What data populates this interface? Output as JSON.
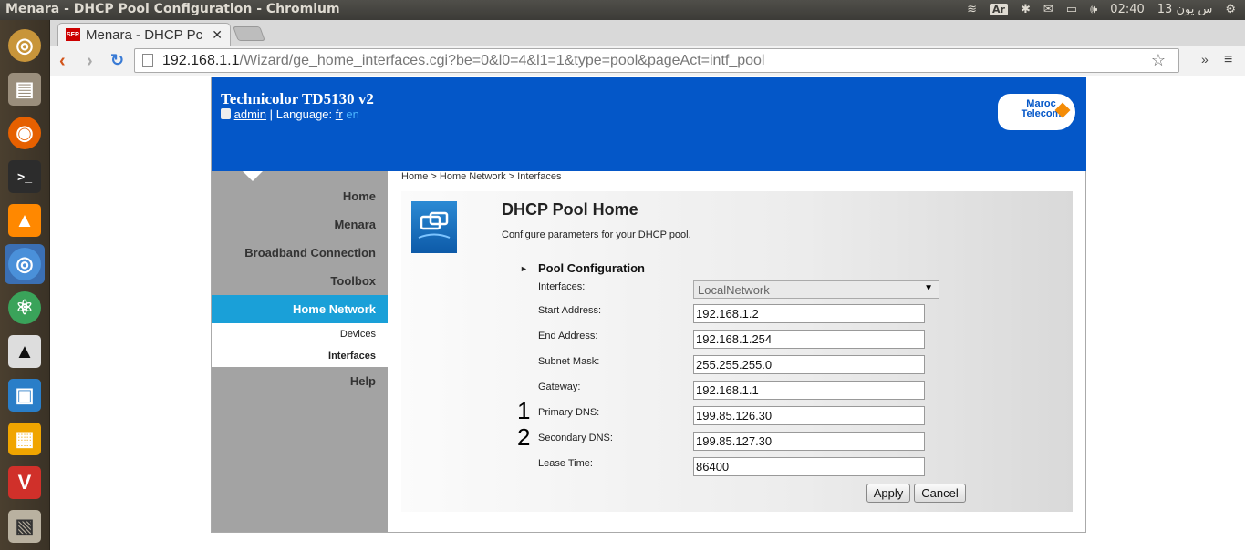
{
  "os": {
    "window_title": "Menara - DHCP Pool Configuration - Chromium",
    "input_indicator": "Ar",
    "clock": "02:40",
    "date": "13 س يون"
  },
  "browser": {
    "tab_title": "Menara - DHCP Pc",
    "tab_favicon": "SFR",
    "url_host": "192.168.1.1",
    "url_path": "/Wizard/ge_home_interfaces.cgi?be=0&l0=4&l1=1&type=pool&pageAct=intf_pool"
  },
  "header": {
    "model": "Technicolor TD5130 v2",
    "user": "admin",
    "language_label": "Language:",
    "lang_fr": "fr",
    "lang_en": "en",
    "logo_line1": "Maroc",
    "logo_line2": "Telecom"
  },
  "sidebar": {
    "home": "Home",
    "menara": "Menara",
    "broadband": "Broadband Connection",
    "toolbox": "Toolbox",
    "home_network": "Home Network",
    "devices": "Devices",
    "interfaces": "Interfaces",
    "help": "Help"
  },
  "breadcrumb": "Home > Home Network > Interfaces",
  "main": {
    "title": "DHCP Pool Home",
    "description": "Configure parameters for your DHCP pool.",
    "section": "Pool Configuration",
    "section_arrow": "►"
  },
  "form": {
    "interfaces_label": "Interfaces:",
    "interfaces_value": "LocalNetwork",
    "start_label": "Start Address:",
    "start_value": "192.168.1.2",
    "end_label": "End Address:",
    "end_value": "192.168.1.254",
    "mask_label": "Subnet Mask:",
    "mask_value": "255.255.255.0",
    "gateway_label": "Gateway:",
    "gateway_value": "192.168.1.1",
    "dns1_label": "Primary DNS:",
    "dns1_value": "199.85.126.30",
    "dns2_label": "Secondary DNS:",
    "dns2_value": "199.85.127.30",
    "lease_label": "Lease Time:",
    "lease_value": "86400",
    "annotation_1": "1",
    "annotation_2": "2",
    "apply": "Apply",
    "cancel": "Cancel"
  }
}
